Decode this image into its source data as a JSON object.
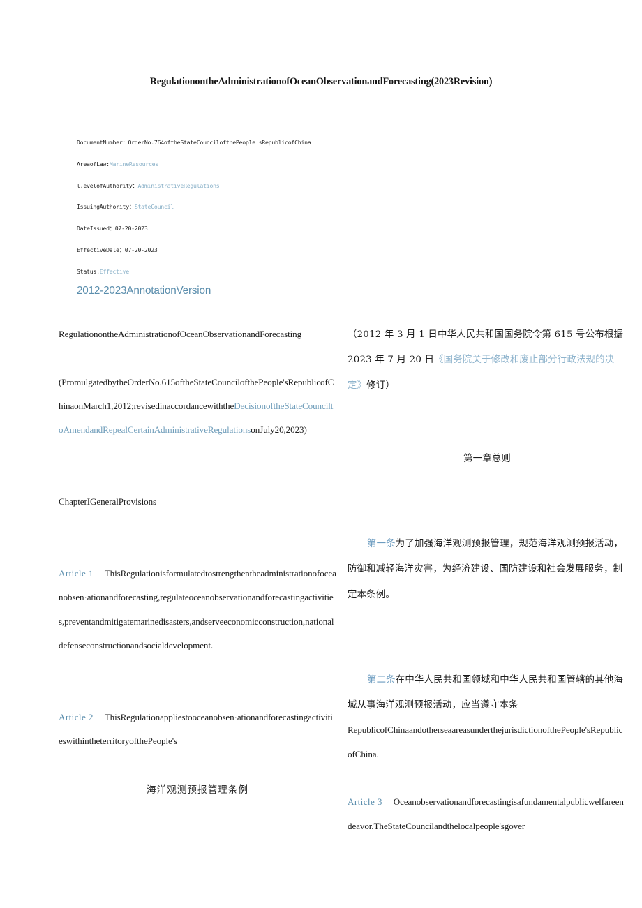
{
  "document": {
    "title": "RegulationontheAdministrationofOceanObservationandForecasting(2023Revision)"
  },
  "metadata": {
    "rows": [
      {
        "label": "DocumentNumber：",
        "value": "OrderNo.764oftheStateCouncilofthePeople'sRepublicofChina",
        "is_link": false
      },
      {
        "label": "AreaofLaw:",
        "value": "MarineResources",
        "is_link": true
      },
      {
        "label": "l.evelofAuthority：",
        "value": "AdministrativeRegulations",
        "is_link": true
      },
      {
        "label": "IssuingAuthority：",
        "value": "StateCouncil",
        "is_link": true
      },
      {
        "label": "DateIssued：",
        "value": "07-20-2023",
        "is_link": false
      },
      {
        "label": "EffectiveDale：",
        "value": "07-20-2023",
        "is_link": false
      },
      {
        "label": "Status:",
        "value": "Effective",
        "is_link": true
      }
    ]
  },
  "annotation": {
    "link_label": "2012-2023AnnotationVersion"
  },
  "left_column": {
    "title_en": "RegulationontheAdministrationofOceanObservationandForecasting",
    "promulgation": {
      "part1": "(PromulgatedbytheOrderNo.615oftheStateCouncilofthePeople'sRepublicofChinaonMarch1,2012;revisedinaccordancewiththe",
      "link": "DecisionoftheStateCounciltoAmendandRepealCertainAdministrativeRegulations",
      "part2": "onJuly20,2023)"
    },
    "chapter_heading": "ChapterIGeneralProvisions",
    "article1": {
      "ref": "Article 1",
      "text": "ThisRegulationisformulatedtostrengthentheadministrationofoceanobsen·ationandforecasting,regulateoceanobservationandforecastingactivities,preventandmitigatemarinedisasters,andserveeconomicconstruction,nationaldefenseconstructionandsocialdevelopment."
    },
    "article2": {
      "ref": "Article 2",
      "text": "ThisRegulationappliestooceanobsen·ationandforecastingactivitieswithintheterritoryofthePeople's"
    },
    "cn_caption": "海洋观测预报管理条例"
  },
  "right_column": {
    "promulgation_cn": {
      "part1": "（2012 年 3 月 1 日中华人民共和国国务院令第 615 号公布根据 2023 年 7 月 20 日",
      "link": "《国务院关于修改和废止部分行政法规的决定》",
      "part2": "修订）"
    },
    "chapter_heading_cn": "第一章总则",
    "article1": {
      "ref_cn": "第一条",
      "text_cn": "为了加强海洋观测预报管理，规范海洋观测预报活动，防御和减轻海洋灾害，为经济建设、国防建设和社会发展服务，制定本条例。"
    },
    "article2": {
      "ref_cn": "第二条",
      "text_cn": "在中华人民共和国领域和中华人民共和国管辖的其他海域从事海洋观测预报活动，应当遵守本条",
      "text_en": "RepublicofChinaandotherseaareasunderthejurisdictionofthePeople'sRepublicofChina."
    },
    "article3": {
      "ref": "Article 3",
      "text": "Oceanobservationandforecastingisafundamentalpublicwelfareendeavor.TheStateCouncilandthelocalpeople'sgover"
    }
  },
  "colors": {
    "link_blue": "#5b8ead",
    "meta_link_blue": "#87afc7",
    "cn_link_blue": "#8fb4cd",
    "body_text": "#1b1b1b",
    "page_background": "#ffffff"
  }
}
